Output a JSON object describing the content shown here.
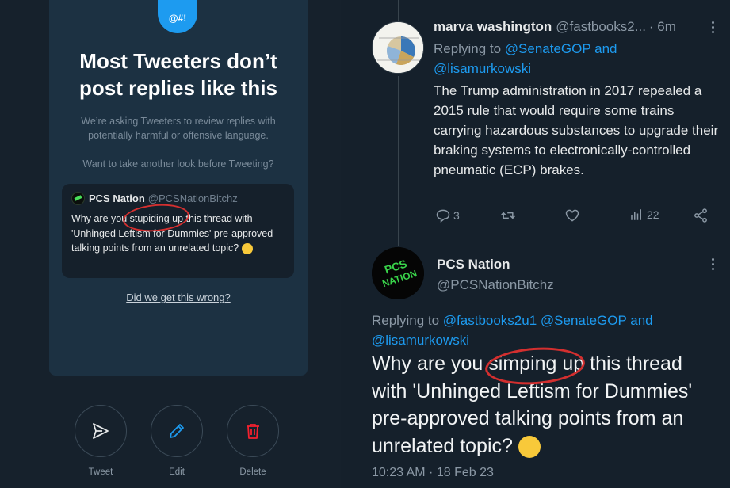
{
  "reply_prompt": {
    "badge": "@#!",
    "title": "Most Tweeters don’t post replies like this",
    "description": "We’re asking Tweeters to review replies with potentially harmful or offensive language.",
    "question": "Want to take another look before Tweeting?",
    "quoted_tweet": {
      "name": "PCS Nation",
      "handle": "@PCSNationBitchz",
      "text_before": "Why are you ",
      "text_highlight": "stupiding u",
      "text_after": "p this thread with 'Unhinged Leftism for Dummies' pre-approved talking points from an unrelated topic?",
      "emoji": "smirk-emoji"
    },
    "feedback_link": "Did we get this wrong?",
    "actions": [
      {
        "label": "Tweet",
        "icon": "send-icon"
      },
      {
        "label": "Edit",
        "icon": "pencil-icon"
      },
      {
        "label": "Delete",
        "icon": "trash-icon"
      }
    ],
    "colors": {
      "accent": "#1d9bf0",
      "delete": "#f4212e",
      "annotation": "#d32f2f"
    }
  },
  "thread": {
    "parent_tweet": {
      "name": "marva washington",
      "handle": "@fastbooks2...",
      "time": "· 6m",
      "replying_prefix": "Replying to ",
      "replying_mention_1": "@SenateGOP",
      "replying_and": " and",
      "replying_mention_2": "@lisamurkowski",
      "text": "The Trump administration in 2017 repealed a 2015 rule that would require some trains carrying hazardous substances to upgrade their braking systems to electronically-controlled pneumatic (ECP) brakes.",
      "stats": {
        "replies": "3",
        "views": "22"
      }
    },
    "reply_tweet": {
      "name": "PCS Nation",
      "handle": "@PCSNationBitchz",
      "avatar_text": "PCS NATION",
      "replying_prefix": "Replying to ",
      "replying_mention_1": "@fastbooks2u1",
      "replying_mention_2": "@SenateGOP",
      "replying_and": " and",
      "replying_mention_3": "@lisamurkowski",
      "text_before": "Why are you ",
      "text_highlight": "simping u",
      "text_after": "p this thread with 'Unhinged Leftism for Dummies' pre-approved talking points from an unrelated topic?",
      "emoji": "smirk-emoji",
      "timestamp": "10:23 AM · 18 Feb 23"
    }
  }
}
